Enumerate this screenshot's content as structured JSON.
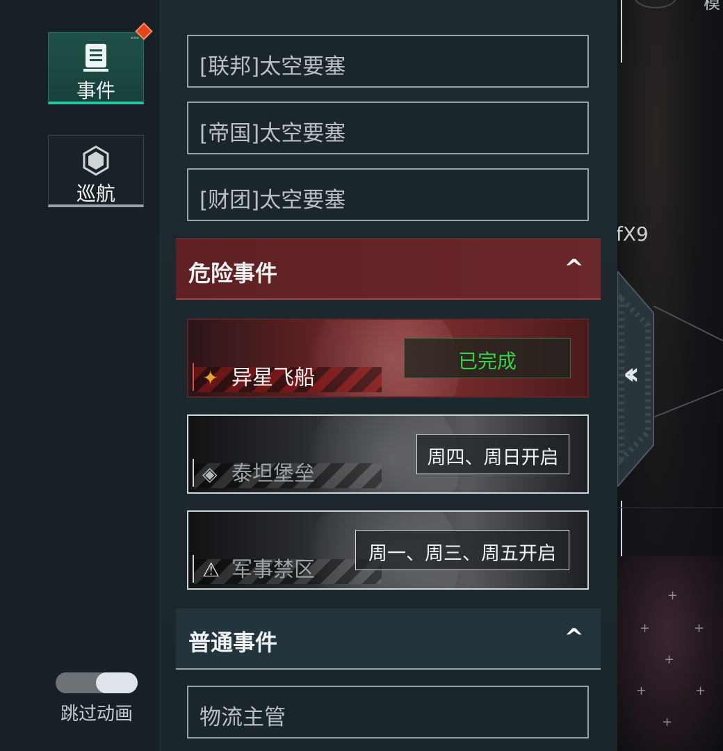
{
  "sidebar": {
    "event_label": "事件",
    "cruise_label": "巡航",
    "skip_animation_label": "跳过动画",
    "skip_animation_on": true
  },
  "event_list": {
    "fortresses": [
      "[联邦]太空要塞",
      "[帝国]太空要塞",
      "[财团]太空要塞"
    ],
    "danger_section_title": "危险事件",
    "danger_events": [
      {
        "name": "异星飞船",
        "status": "已完成"
      },
      {
        "name": "泰坦堡垒",
        "schedule": "周四、周日开启"
      },
      {
        "name": "军事禁区",
        "schedule": "周一、周三、周五开启"
      }
    ],
    "normal_section_title": "普通事件",
    "normal_events": [
      "物流主管"
    ]
  },
  "map": {
    "node_label": "fX9",
    "top_right_char": "模"
  },
  "icons": {
    "event": "document-icon",
    "cruise": "hexagon-icon",
    "collapse": "double-chevron-left-icon",
    "section_toggle": "chevron-up-icon",
    "alien_ship": "alien-ship-icon",
    "titan": "titan-emblem-icon",
    "zone": "warning-icon"
  },
  "colors": {
    "accent": "#27c6a4",
    "danger": "#6a2729",
    "completed": "#35d34a",
    "notification": "#e2441d"
  }
}
